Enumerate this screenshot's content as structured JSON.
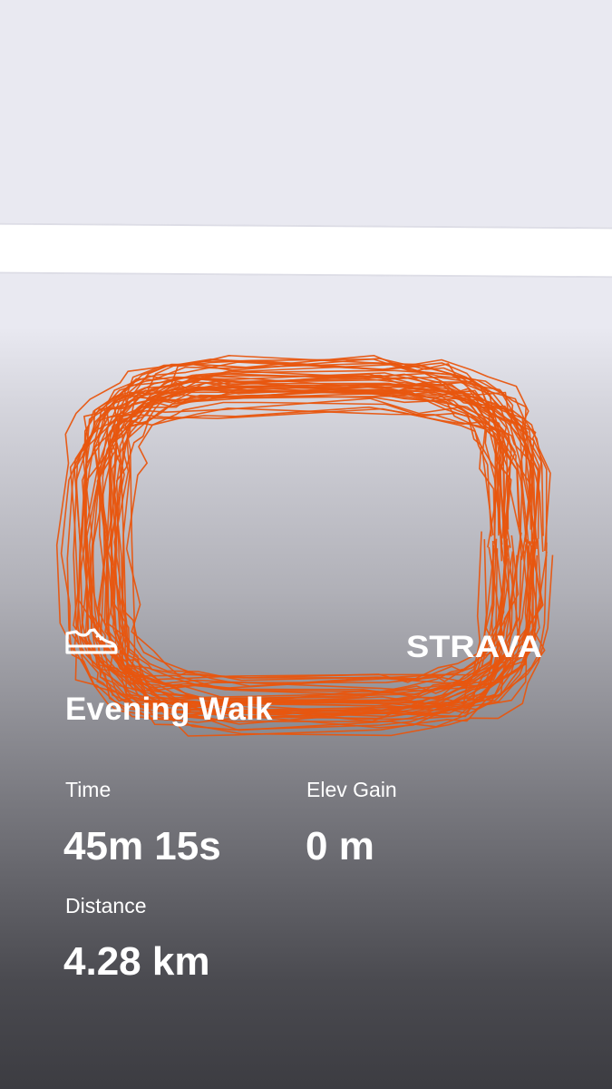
{
  "activity": {
    "title": "Evening Walk",
    "type_icon": "shoe-icon",
    "brand": "STRAVA"
  },
  "stats": {
    "time": {
      "label": "Time",
      "value": "45m 15s"
    },
    "elev_gain": {
      "label": "Elev Gain",
      "value": "0 m"
    },
    "distance": {
      "label": "Distance",
      "value": "4.28 km"
    }
  },
  "colors": {
    "route": "#e8560f",
    "text": "#ffffff",
    "map_background": "#e9e9f1",
    "road": "#ffffff"
  }
}
